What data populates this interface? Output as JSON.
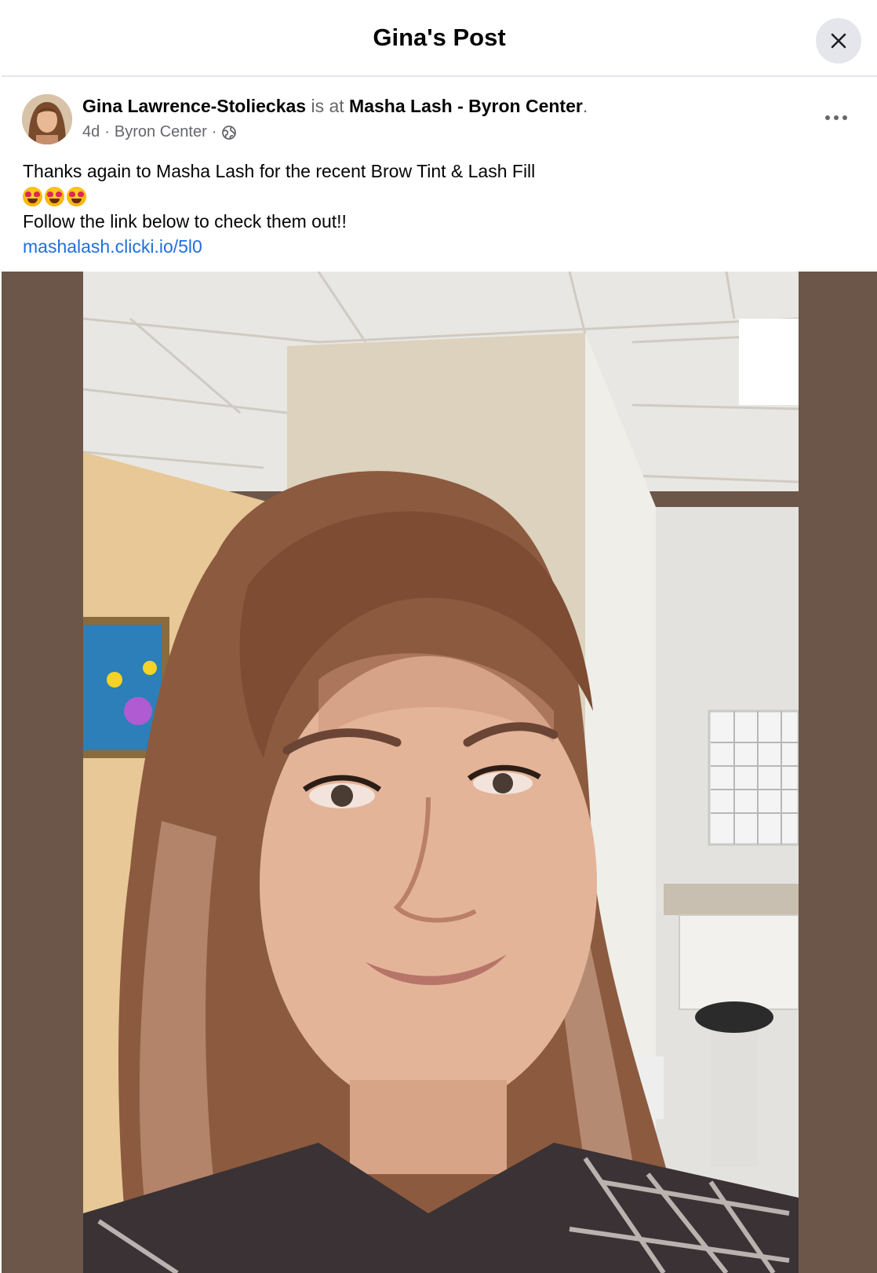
{
  "header": {
    "title": "Gina's Post"
  },
  "post": {
    "author": "Gina Lawrence-Stolieckas",
    "connector": "is at",
    "place": "Masha Lash - Byron Center",
    "place_suffix": ".",
    "time": "4d",
    "location": "Byron Center",
    "separator": "·",
    "text_line1": "Thanks again to Masha Lash for the recent Brow Tint & Lash Fill",
    "emoji_names": [
      "heart-eyes-emoji",
      "heart-eyes-emoji",
      "heart-eyes-emoji"
    ],
    "text_line2": "Follow the link below to check them out!!",
    "link": "mashalash.clicki.io/5l0"
  },
  "icons": {
    "close": "close-icon",
    "more": "more-options-icon",
    "audience": "globe-icon"
  },
  "colors": {
    "link": "#216fdb",
    "photo_backdrop": "#6c5649",
    "secondary_text": "#65676b"
  }
}
